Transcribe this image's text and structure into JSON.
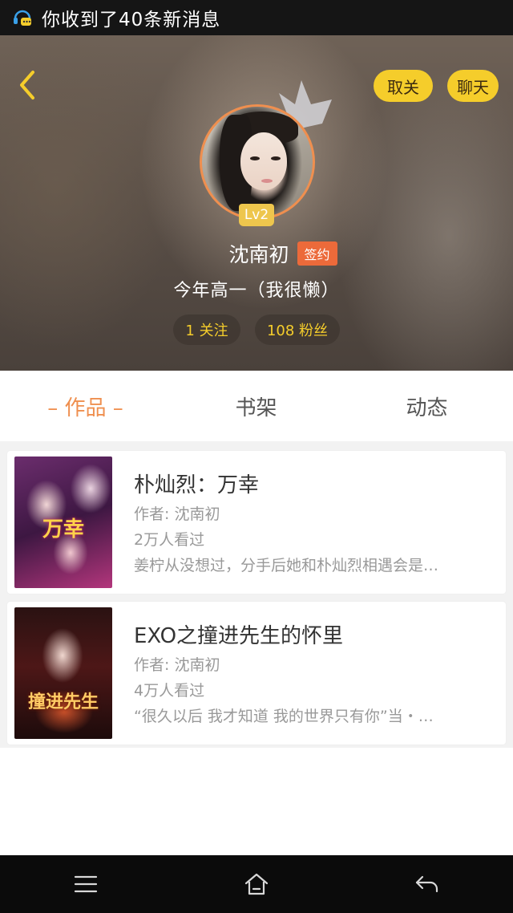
{
  "status_bar": {
    "notification_text": "你收到了40条新消息",
    "icon": "headset-chat-icon"
  },
  "header": {
    "back_icon": "chevron-left-icon",
    "unfollow_label": "取关",
    "chat_label": "聊天",
    "level": "Lv2",
    "user_name": "沈南初",
    "signed_badge": "签约",
    "bio": "今年高一（我很懒）",
    "following": "1 关注",
    "followers": "108 粉丝",
    "accent_color": "#f5cd2b",
    "avatar_border_color": "#ef8f4f"
  },
  "tabs": [
    {
      "label": "– 作品 –",
      "active": true
    },
    {
      "label": "书架",
      "active": false
    },
    {
      "label": "动态",
      "active": false
    }
  ],
  "tab_active_color": "#ef8f4f",
  "books": [
    {
      "cover_text": "万幸",
      "title": "朴灿烈：万幸",
      "author": "作者: 沈南初",
      "views": "2万人看过",
      "description": "姜柠从没想过，分手后她和朴灿烈相遇会是…"
    },
    {
      "cover_text": "撞进先生",
      "title": "EXO之撞进先生的怀里",
      "author": "作者: 沈南初",
      "views": "4万人看过",
      "description": "“很久以后 我才知道 我的世界只有你”当・…"
    }
  ],
  "nav": {
    "menu_icon": "menu-icon",
    "home_icon": "home-icon",
    "back_icon": "back-arrow-icon"
  }
}
